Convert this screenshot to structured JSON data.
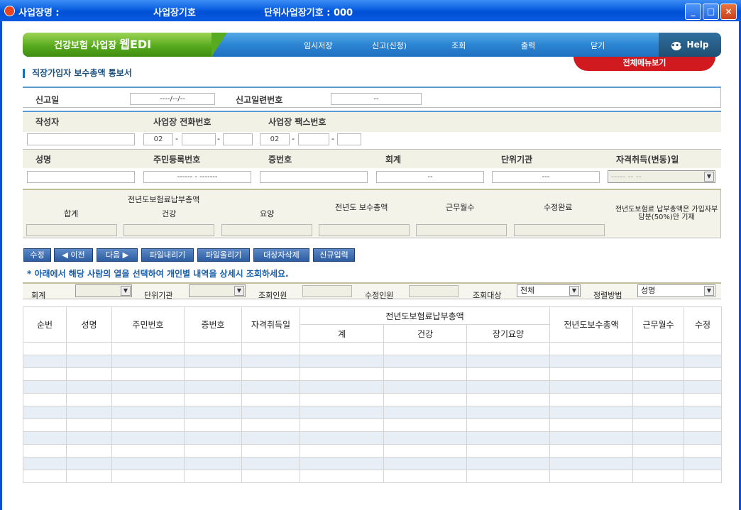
{
  "window": {
    "title_label": "사업장명 :",
    "business_no_label": "사업장기호",
    "unit_business_label": "단위사업장기호 : 000",
    "minimize": "_",
    "maximize": "□",
    "close": "×"
  },
  "topbar": {
    "brand": "건강보험 사업장",
    "brand_bold": "웹EDI",
    "menu": [
      "임시저장",
      "신고(신청)",
      "조회",
      "출력",
      "닫기"
    ],
    "help": "Help",
    "full_menu": "전체메뉴보기"
  },
  "page_title": "직장가입자 보수총액 통보서",
  "form": {
    "report_date_label": "신고일",
    "report_date_value": "----/--/--",
    "report_serial_label": "신고일련번호",
    "report_serial_value": "--",
    "writer_label": "작성자",
    "phone_label": "사업장 전화번호",
    "fax_label": "사업장 팩스번호",
    "phone_prefix": "02",
    "fax_prefix": "02",
    "name_label": "성명",
    "rrn_label": "주민등록번호",
    "rrn_value": "------ - -------",
    "card_no_label": "증번호",
    "account_label": "회계",
    "account_value": "--",
    "unit_org_label": "단위기관",
    "unit_org_value": "---",
    "qualify_date_label": "자격취득(변동)일",
    "qualify_date_value": "----- -- --"
  },
  "summary": {
    "prev_premium_total": "전년도보험료납부총액",
    "total": "합계",
    "health": "건강",
    "care": "요양",
    "prev_salary_total": "전년도 보수총액",
    "work_months": "근무월수",
    "edit_done": "수정완료",
    "note": "전년도보험료 납부총액은 가입자부담분(50%)만 기재"
  },
  "buttons": {
    "edit": "수정",
    "prev": "◀ 이전",
    "next": "다음 ▶",
    "file_download": "파일내리기",
    "file_upload": "파일올리기",
    "delete_target": "대상자삭제",
    "new_entry": "신규입력"
  },
  "hint": "* 아래에서 해당 사람의 열을 선택하여 개인별 내역을 상세시 조회하세요.",
  "filters": {
    "account_label": "회계",
    "unit_org_label": "단위기관",
    "query_count_label": "조회인원",
    "edit_count_label": "수정인원",
    "query_target_label": "조회대상",
    "query_target_value": "전체",
    "sort_label": "정렬방법",
    "sort_value": "성명"
  },
  "grid": {
    "seq": "순번",
    "name": "성명",
    "rrn": "주민번호",
    "card_no": "증번호",
    "qualify_date": "자격취득일",
    "prev_premium_total": "전년도보험료납부총액",
    "sub_total": "계",
    "sub_health": "건강",
    "sub_ltc": "장기요양",
    "prev_salary_total": "전년도보수총액",
    "work_months": "근무월수",
    "edit": "수정"
  },
  "colors": {
    "accent_blue": "#2d86d3",
    "brand_green": "#58aa1e",
    "full_menu_red": "#d01a20",
    "title_blue": "#0a5fe0"
  }
}
